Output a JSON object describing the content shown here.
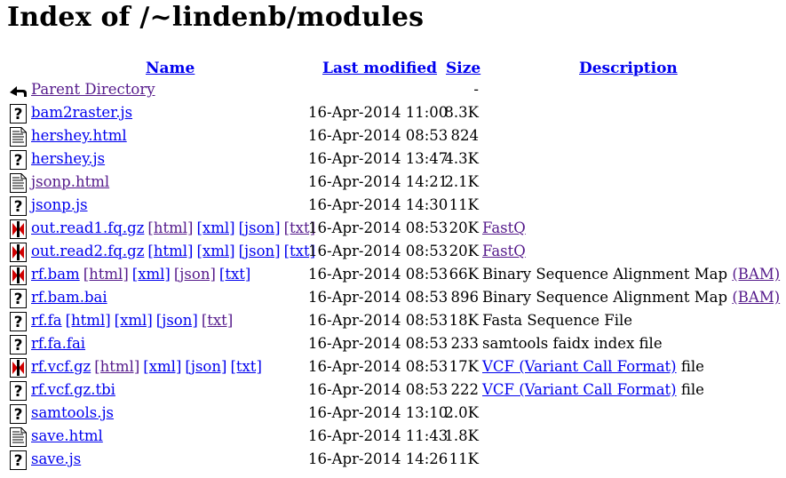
{
  "page": {
    "title": "Index of /~lindenb/modules"
  },
  "columns": {
    "name": "Name",
    "last_modified": "Last modified",
    "size": "Size",
    "description": "Description"
  },
  "rows": [
    {
      "icon": "back-icon",
      "name": "Parent Directory",
      "visited": true,
      "formats": [],
      "date": "",
      "size": "-",
      "desc": []
    },
    {
      "icon": "unknown-file-icon",
      "name": "bam2raster.js",
      "visited": false,
      "formats": [],
      "date": "16-Apr-2014 11:00",
      "size": "8.3K",
      "desc": []
    },
    {
      "icon": "text-file-icon",
      "name": "hershey.html",
      "visited": false,
      "formats": [],
      "date": "16-Apr-2014 08:53",
      "size": "824",
      "desc": []
    },
    {
      "icon": "unknown-file-icon",
      "name": "hershey.js",
      "visited": false,
      "formats": [],
      "date": "16-Apr-2014 13:47",
      "size": "4.3K",
      "desc": []
    },
    {
      "icon": "text-file-icon",
      "name": "jsonp.html",
      "visited": true,
      "formats": [],
      "date": "16-Apr-2014 14:21",
      "size": "2.1K",
      "desc": []
    },
    {
      "icon": "unknown-file-icon",
      "name": "jsonp.js",
      "visited": false,
      "formats": [],
      "date": "16-Apr-2014 14:30",
      "size": "11K",
      "desc": []
    },
    {
      "icon": "binary-file-icon",
      "name": "out.read1.fq.gz",
      "visited": false,
      "formats": [
        {
          "label": "[html]",
          "visited": true
        },
        {
          "label": "[xml]",
          "visited": false
        },
        {
          "label": "[json]",
          "visited": false
        },
        {
          "label": "[txt]",
          "visited": true
        }
      ],
      "date": "16-Apr-2014 08:53",
      "size": "20K",
      "desc": [
        {
          "text": "FastQ",
          "link": true,
          "visited": true
        }
      ]
    },
    {
      "icon": "binary-file-icon",
      "name": "out.read2.fq.gz",
      "visited": false,
      "formats": [
        {
          "label": "[html]",
          "visited": false
        },
        {
          "label": "[xml]",
          "visited": false
        },
        {
          "label": "[json]",
          "visited": false
        },
        {
          "label": "[txt]",
          "visited": false
        }
      ],
      "date": "16-Apr-2014 08:53",
      "size": "20K",
      "desc": [
        {
          "text": "FastQ",
          "link": true,
          "visited": true
        }
      ]
    },
    {
      "icon": "binary-file-icon",
      "name": "rf.bam",
      "visited": false,
      "formats": [
        {
          "label": "[html]",
          "visited": true
        },
        {
          "label": "[xml]",
          "visited": false
        },
        {
          "label": "[json]",
          "visited": true
        },
        {
          "label": "[txt]",
          "visited": false
        }
      ],
      "date": "16-Apr-2014 08:53",
      "size": "66K",
      "desc": [
        {
          "text": "Binary Sequence Alignment Map ",
          "link": false
        },
        {
          "text": "(BAM)",
          "link": true,
          "visited": true
        }
      ]
    },
    {
      "icon": "unknown-file-icon",
      "name": "rf.bam.bai",
      "visited": false,
      "formats": [],
      "date": "16-Apr-2014 08:53",
      "size": "896",
      "desc": [
        {
          "text": "Binary Sequence Alignment Map ",
          "link": false
        },
        {
          "text": "(BAM)",
          "link": true,
          "visited": true
        }
      ]
    },
    {
      "icon": "unknown-file-icon",
      "name": "rf.fa",
      "visited": false,
      "formats": [
        {
          "label": "[html]",
          "visited": false
        },
        {
          "label": "[xml]",
          "visited": false
        },
        {
          "label": "[json]",
          "visited": false
        },
        {
          "label": "[txt]",
          "visited": true
        }
      ],
      "date": "16-Apr-2014 08:53",
      "size": "18K",
      "desc": [
        {
          "text": "Fasta Sequence File",
          "link": false
        }
      ]
    },
    {
      "icon": "unknown-file-icon",
      "name": "rf.fa.fai",
      "visited": false,
      "formats": [],
      "date": "16-Apr-2014 08:53",
      "size": "233",
      "desc": [
        {
          "text": "samtools faidx index file",
          "link": false
        }
      ]
    },
    {
      "icon": "binary-file-icon",
      "name": "rf.vcf.gz",
      "visited": false,
      "formats": [
        {
          "label": "[html]",
          "visited": true
        },
        {
          "label": "[xml]",
          "visited": false
        },
        {
          "label": "[json]",
          "visited": false
        },
        {
          "label": "[txt]",
          "visited": false
        }
      ],
      "date": "16-Apr-2014 08:53",
      "size": "17K",
      "desc": [
        {
          "text": "VCF (Variant Call Format)",
          "link": true,
          "visited": false
        },
        {
          "text": " file",
          "link": false
        }
      ]
    },
    {
      "icon": "unknown-file-icon",
      "name": "rf.vcf.gz.tbi",
      "visited": false,
      "formats": [],
      "date": "16-Apr-2014 08:53",
      "size": "222",
      "desc": [
        {
          "text": "VCF (Variant Call Format)",
          "link": true,
          "visited": false
        },
        {
          "text": " file",
          "link": false
        }
      ]
    },
    {
      "icon": "unknown-file-icon",
      "name": "samtools.js",
      "visited": false,
      "formats": [],
      "date": "16-Apr-2014 13:10",
      "size": "2.0K",
      "desc": []
    },
    {
      "icon": "text-file-icon",
      "name": "save.html",
      "visited": false,
      "formats": [],
      "date": "16-Apr-2014 11:43",
      "size": "1.8K",
      "desc": []
    },
    {
      "icon": "unknown-file-icon",
      "name": "save.js",
      "visited": false,
      "formats": [],
      "date": "16-Apr-2014 14:26",
      "size": "11K",
      "desc": []
    }
  ],
  "colors": {
    "link": "#0000ee",
    "visited": "#551a8b",
    "background": "#ffffff"
  }
}
